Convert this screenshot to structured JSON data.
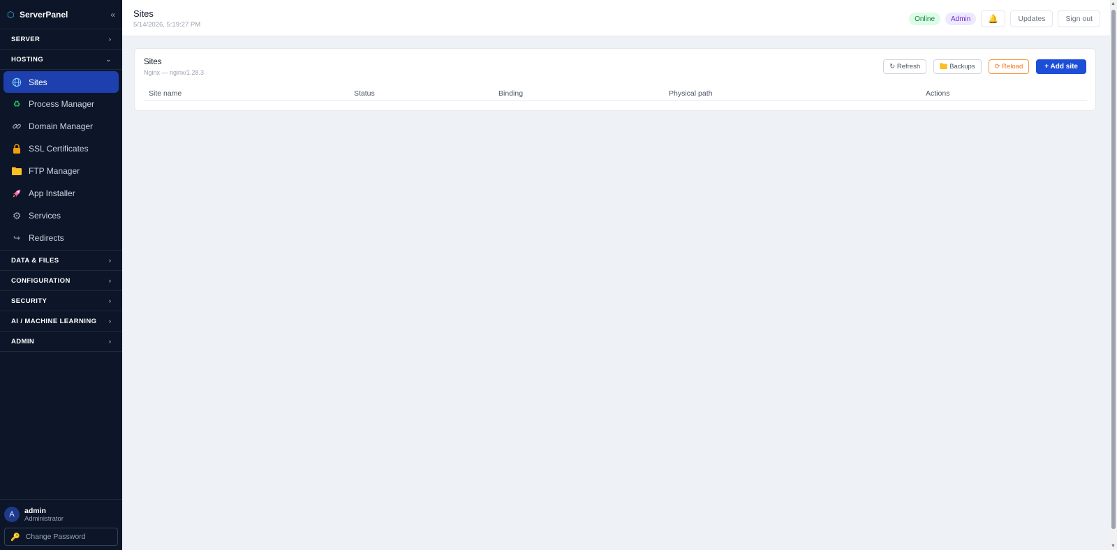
{
  "brand": {
    "name": "ServerPanel",
    "logo_icon": "hexagon-icon",
    "collapse_icon": "double-chevron-left-icon"
  },
  "sidebar": {
    "sections_top": [
      {
        "label": "SERVER",
        "expanded": false
      },
      {
        "label": "HOSTING",
        "expanded": true
      }
    ],
    "hosting_items": [
      {
        "label": "Sites",
        "icon": "globe-icon",
        "active": true
      },
      {
        "label": "Process Manager",
        "icon": "recycle-icon"
      },
      {
        "label": "Domain Manager",
        "icon": "link-icon"
      },
      {
        "label": "SSL Certificates",
        "icon": "lock-icon"
      },
      {
        "label": "FTP Manager",
        "icon": "folder-icon"
      },
      {
        "label": "App Installer",
        "icon": "rocket-icon"
      },
      {
        "label": "Services",
        "icon": "gear-icon"
      },
      {
        "label": "Redirects",
        "icon": "redirect-arrow-icon"
      }
    ],
    "sections_bottom": [
      {
        "label": "DATA & FILES"
      },
      {
        "label": "CONFIGURATION"
      },
      {
        "label": "SECURITY"
      },
      {
        "label": "AI / MACHINE LEARNING"
      },
      {
        "label": "ADMIN"
      }
    ]
  },
  "user": {
    "avatar_letter": "A",
    "name": "admin",
    "role": "Administrator",
    "change_password": "Change Password"
  },
  "topbar": {
    "title": "Sites",
    "timestamp": "5/14/2026, 5:19:27 PM",
    "status_badge": "Online",
    "role_badge": "Admin",
    "bell_glyph": "🔔",
    "updates": "Updates",
    "sign_out": "Sign out"
  },
  "card": {
    "title": "Sites",
    "subtitle": "Nginx — nginx/1.28.3",
    "refresh": "↻ Refresh",
    "backups": "Backups",
    "reload": "⟳ Reload",
    "add_site": "+ Add site"
  },
  "table": {
    "columns": [
      "Site name",
      "Status",
      "Binding",
      "Physical path",
      "Actions"
    ],
    "rows": []
  },
  "colors": {
    "sidebar_bg": "#0d1628",
    "accent": "#1d4ed8",
    "active_item": "#1e40af",
    "reload": "#f97316"
  }
}
